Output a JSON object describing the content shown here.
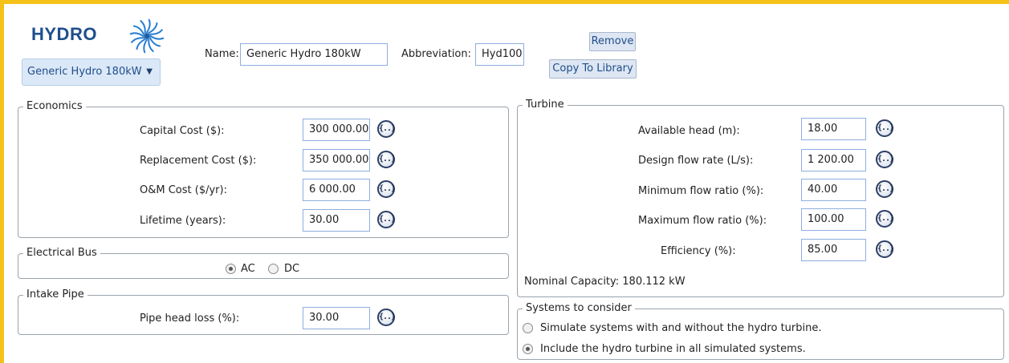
{
  "header": {
    "title": "HYDRO",
    "name_label": "Name:",
    "name_value": "Generic Hydro 180kW",
    "abbr_label": "Abbreviation:",
    "abbr_value": "Hyd100",
    "remove_label": "Remove",
    "copy_label": "Copy To Library",
    "dropdown_value": "Generic Hydro 180kW",
    "logo_icon": "hydro-turbine-icon",
    "accent_color": "#f5c219",
    "title_color": "#1f4e8c"
  },
  "economics": {
    "title": "Economics",
    "rows": [
      {
        "label": "Capital Cost ($):",
        "value": "300 000.00"
      },
      {
        "label": "Replacement Cost ($):",
        "value": "350 000.00"
      },
      {
        "label": "O&M Cost ($/yr):",
        "value": "6 000.00"
      },
      {
        "label": "Lifetime (years):",
        "value": "30.00"
      }
    ]
  },
  "electrical_bus": {
    "title": "Electrical Bus",
    "options": [
      "AC",
      "DC"
    ],
    "selected": "AC"
  },
  "intake_pipe": {
    "title": "Intake Pipe",
    "label": "Pipe head loss (%):",
    "value": "30.00"
  },
  "turbine": {
    "title": "Turbine",
    "rows": [
      {
        "label": "Available head (m):",
        "value": "18.00"
      },
      {
        "label": "Design flow rate (L/s):",
        "value": "1 200.00"
      },
      {
        "label": "Minimum flow ratio (%):",
        "value": "40.00"
      },
      {
        "label": "Maximum flow ratio (%):",
        "value": "100.00"
      },
      {
        "label": "Efficiency (%):",
        "value": "85.00"
      }
    ],
    "nominal_capacity": "Nominal Capacity: 180.112 kW"
  },
  "systems": {
    "title": "Systems to consider",
    "options": [
      "Simulate systems with and without the hydro turbine.",
      "Include the hydro turbine in all simulated systems."
    ],
    "selected_index": 1
  },
  "sensitivity_glyph": "{..}"
}
